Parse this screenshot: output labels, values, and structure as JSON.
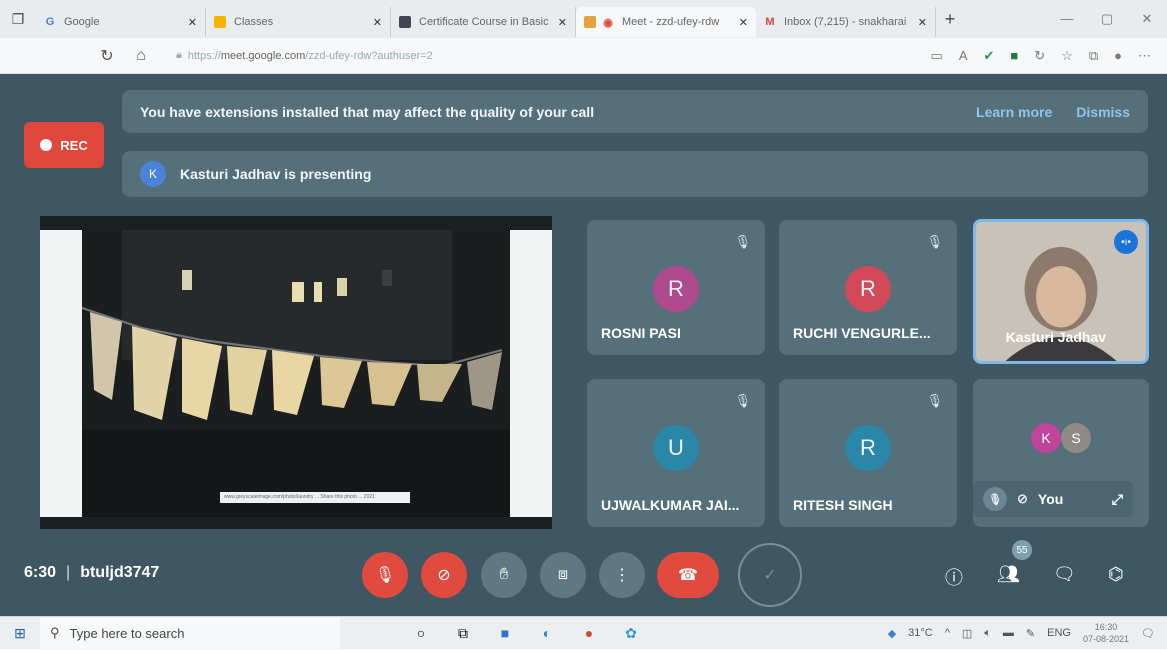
{
  "tabs": [
    {
      "title": "Google",
      "fav": "G",
      "favColor": "#4a7fd4"
    },
    {
      "title": "Classes",
      "fav": "■",
      "favColor": "#f4b400"
    },
    {
      "title": "Certificate Course in Basic",
      "fav": "■",
      "favColor": "#445"
    },
    {
      "title": "Meet - zzd-ufey-rdw",
      "fav": "◉",
      "favColor": "#e34b3f"
    },
    {
      "title": "Inbox (7,215) - snakharai",
      "fav": "M",
      "favColor": "#d44638"
    }
  ],
  "address": {
    "prefix": "https://",
    "host": "meet.google.com",
    "path": "/zzd-ufey-rdw?authuser=2"
  },
  "banner": {
    "text": "You have extensions installed that may affect the quality of your call",
    "learn_more": "Learn more",
    "dismiss": "Dismiss"
  },
  "rec_label": "REC",
  "presenting": {
    "initial": "K",
    "text": "Kasturi Jadhav is presenting"
  },
  "presentation_caption": "www.greyscaleimage.com/photo/laundry ... Share this photo ... 2021",
  "participants": [
    {
      "name": "ROSNI PASI",
      "initial": "R",
      "color": "#b04a8e"
    },
    {
      "name": "RUCHI VENGURLE...",
      "initial": "R",
      "color": "#d24a5a"
    },
    {
      "name": "UJWALKUMAR JAI...",
      "initial": "U",
      "color": "#2a87a8"
    },
    {
      "name": "RITESH SINGH",
      "initial": "R",
      "color": "#2a87a8"
    }
  ],
  "speaker": {
    "name": "Kasturi Jadhav"
  },
  "self_tile": {
    "avatars": [
      {
        "initial": "K",
        "color": "#c0449c"
      },
      {
        "initial": "S",
        "color": "#8f8a86"
      }
    ],
    "label": "You"
  },
  "meeting": {
    "time": "6:30",
    "code": "btuljd3747"
  },
  "people_count": "55",
  "taskbar": {
    "search_placeholder": "Type here to search",
    "temperature": "31°C",
    "lang": "ENG",
    "time": "16:30",
    "date": "07-08-2021"
  },
  "icons": {
    "mic_off": "mic-off-icon",
    "cam_off": "camera-off-icon",
    "hand": "raise-hand-icon",
    "present": "present-icon",
    "more": "more-options-icon",
    "leave": "leave-call-icon"
  }
}
